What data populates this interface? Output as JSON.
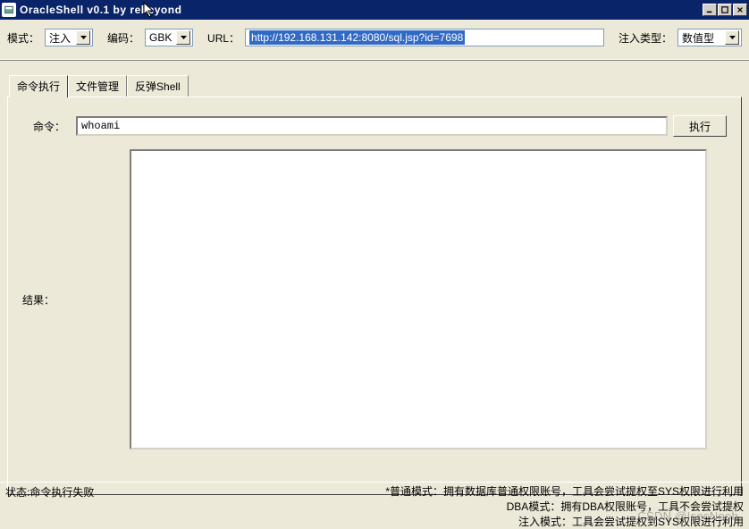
{
  "window": {
    "title": "OracleShell v0.1  by rebeyond"
  },
  "toolbar": {
    "mode_label": "模式：",
    "mode_value": "注入",
    "encoding_label": "编码：",
    "encoding_value": "GBK",
    "url_label": "URL：",
    "url_value": "http://192.168.131.142:8080/sql.jsp?id=7698",
    "inject_type_label": "注入类型：",
    "inject_type_value": "数值型"
  },
  "tabs": {
    "items": [
      {
        "label": "命令执行",
        "active": true
      },
      {
        "label": "文件管理",
        "active": false
      },
      {
        "label": "反弹Shell",
        "active": false
      }
    ]
  },
  "panel": {
    "cmd_label": "命令：",
    "cmd_value": "whoami",
    "exec_label": "执行",
    "result_label": "结果："
  },
  "status": {
    "left": "状态:命令执行失败",
    "right_lines": [
      "*普通模式：拥有数据库普通权限账号，工具会尝试提权至SYS权限进行利用",
      "DBA模式：拥有DBA权限账号，工具不会尝试提权",
      "注入模式：工具会尝试提权到SYS权限进行利用"
    ]
  },
  "watermark": "CSDN @IsecNoob"
}
